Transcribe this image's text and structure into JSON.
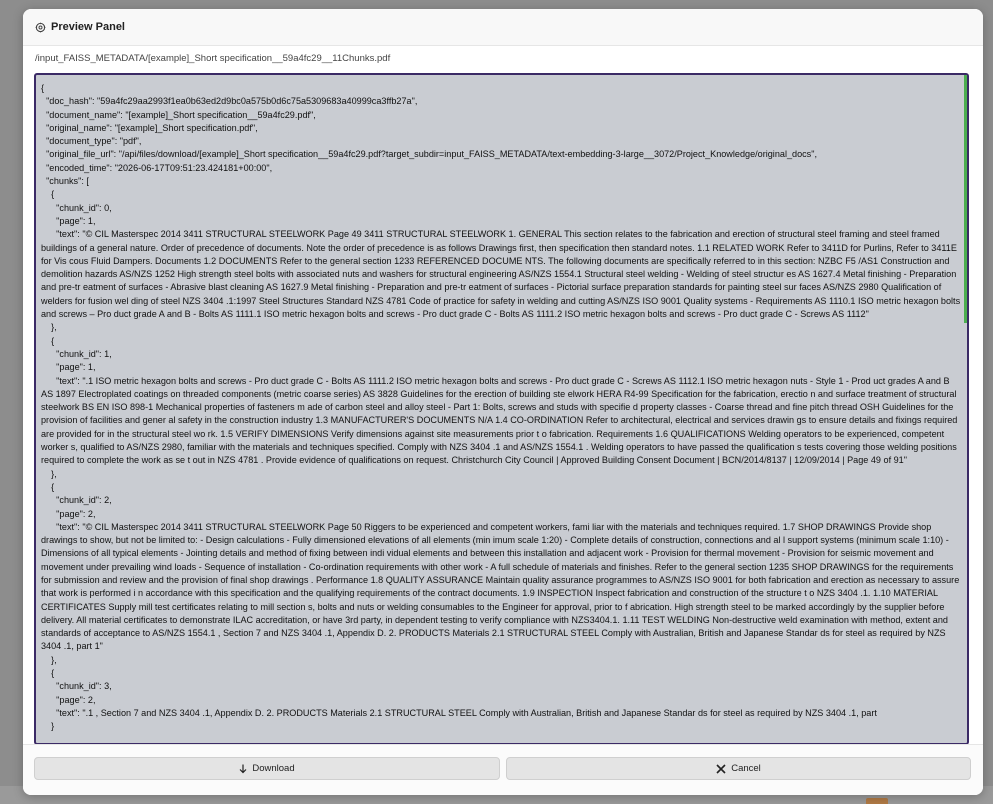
{
  "panel": {
    "title": "Preview Panel",
    "title_icon": "preview-gear-icon",
    "file_path": "/input_FAISS_METADATA/[example]_Short specification__59a4fc29__11Chunks.pdf"
  },
  "document": {
    "doc_hash": "59a4fc29aa2993f1ea0b63ed2d9bc0a575b0d6c75a5309683a40999ca3ffb27a",
    "document_name": "[example]_Short specification__59a4fc29.pdf",
    "original_name": "[example]_Short specification.pdf",
    "document_type": "pdf",
    "original_file_url": "/api/files/download/[example]_Short specification__59a4fc29.pdf?target_subdir=input_FAISS_METADATA/text-embedding-3-large__3072/Project_Knowledge/original_docs",
    "encoded_time": "2026-06-17T09:51:23.424181+00:00",
    "chunks": [
      {
        "chunk_id": 0,
        "page": 1,
        "text": "\"© CIL Masterspec 2014 3411 STRUCTURAL STEELWORK Page 49 3411 STRUCTURAL STEELWORK 1. GENERAL This section relates to the fabrication and erection of structural steel framing and steel framed buildings of a general nature. Order of precedence of documents. Note the order of precedence is as follows Drawings first, then specification then standard notes. 1.1 RELATED WORK Refer to 3411D for Purlins, Refer to 3411E for Vis cous Fluid Dampers. Documents 1.2 DOCUMENTS Refer to the general section 1233 REFERENCED DOCUME NTS. The following documents are specifically referred to in this section: NZBC F5 /AS1 Construction and demolition hazards AS/NZS 1252 High strength steel bolts with associated nuts and washers for structural engineering AS/NZS 1554.1 Structural steel welding - Welding of steel structur es AS 1627.4 Metal finishing - Preparation and pre-tr eatment of surfaces - Abrasive blast cleaning AS 1627.9 Metal finishing - Preparation and pre-tr eatment of surfaces - Pictorial surface preparation standards for painting steel sur faces AS/NZS 2980 Qualification of welders for fusion wel ding of steel NZS 3404 .1:1997 Steel Structures Standard NZS 4781 Code of practice for safety in welding and cutting AS/NZS ISO 9001 Quality systems - Requirements AS 1110.1 ISO metric hexagon bolts and screws – Pro duct grade A and B - Bolts AS 1111.1 ISO metric hexagon bolts and screws - Pro duct grade C - Bolts AS 1111.2 ISO metric hexagon bolts and screws - Pro duct grade C - Screws AS 1112\""
      },
      {
        "chunk_id": 1,
        "page": 1,
        "text": "\".1 ISO metric hexagon bolts and screws - Pro duct grade C - Bolts AS 1111.2 ISO metric hexagon bolts and screws - Pro duct grade C - Screws AS 1112.1 ISO metric hexagon nuts - Style 1 - Prod uct grades A and B AS 1897 Electroplated coatings on threaded components (metric coarse series) AS 3828 Guidelines for the erection of building ste elwork HERA R4-99 Specification for the fabrication, erectio n and surface treatment of structural steelwork BS EN ISO 898-1 Mechanical properties of fasteners m ade of carbon steel and alloy steel - Part 1: Bolts, screws and studs with specifie d property classes - Coarse thread and fine pitch thread OSH Guidelines for the provision of facilities and gener al safety in the construction industry 1.3 MANUFACTURER'S DOCUMENTS N/A 1.4 CO-ORDINATION Refer to architectural, electrical and services drawin gs to ensure details and fixings required are provided for in the structural steel wo rk. 1.5 VERIFY DIMENSIONS Verify dimensions against site measurements prior t o fabrication. Requirements 1.6 QUALIFICATIONS Welding operators to be experienced, competent worker s, qualified to AS/NZS 2980, familiar with the materials and techniques specified. Comply with NZS 3404 .1 and AS/NZS 1554.1 . Welding operators to have passed the qualification s tests covering those welding positions required to complete the work as se t out in NZS 4781 . Provide evidence of qualifications on request. Christchurch City Council | Approved Building Consent Document | BCN/2014/8137 | 12/09/2014 | Page 49 of 91\""
      },
      {
        "chunk_id": 2,
        "page": 2,
        "text": "\"© CIL Masterspec 2014 3411 STRUCTURAL STEELWORK Page 50 Riggers to be experienced and competent workers, fami liar with the materials and techniques required. 1.7 SHOP DRAWINGS Provide shop drawings to show, but not be limited to: - Design calculations - Fully dimensioned elevations of all elements (min imum scale 1:20) - Complete details of construction, connections and al l support systems (minimum scale 1:10) - Dimensions of all typical elements - Jointing details and method of fixing between indi vidual elements and between this installation and adjacent work - Provision for thermal movement - Provision for seismic movement and movement under prevailing wind loads - Sequence of installation - Co-ordination requirements with other work - A full schedule of materials and finishes. Refer to the general section 1235 SHOP DRAWINGS for the requirements for submission and review and the provision of final shop drawings . Performance 1.8 QUALITY ASSURANCE Maintain quality assurance programmes to AS/NZS ISO 9001 for both fabrication and erection as necessary to assure that work is performed i n accordance with this specification and the qualifying requirements of the contract documents. 1.9 INSPECTION Inspect fabrication and construction of the structure t o NZS 3404 .1. 1.10 MATERIAL CERTIFICATES Supply mill test certificates relating to mill section s, bolts and nuts or welding consumables to the Engineer for approval, prior to f abrication. High strength steel to be marked accordingly by the supplier before delivery. All material certificates to demonstrate ILAC accreditation, or have 3rd party, in dependent testing to verify compliance with NZS3404.1. 1.11 TEST WELDING Non-destructive weld examination with method, extent and standards of acceptance to AS/NZS 1554.1 , Section 7 and NZS 3404 .1, Appendix D. 2. PRODUCTS Materials 2.1 STRUCTURAL STEEL Comply with Australian, British and Japanese Standar ds for steel as required by NZS 3404 .1, part 1\""
      },
      {
        "chunk_id": 3,
        "page": 2,
        "text": "\".1 , Section 7 and NZS 3404 .1, Appendix D. 2. PRODUCTS Materials 2.1 STRUCTURAL STEEL Comply with Australian, British and Japanese Standar ds for steel as required by NZS 3404 .1, part"
      }
    ]
  },
  "footer": {
    "download_label": "Download",
    "download_icon": "download-arrow-icon",
    "cancel_label": "Cancel",
    "cancel_icon": "close-x-icon"
  }
}
